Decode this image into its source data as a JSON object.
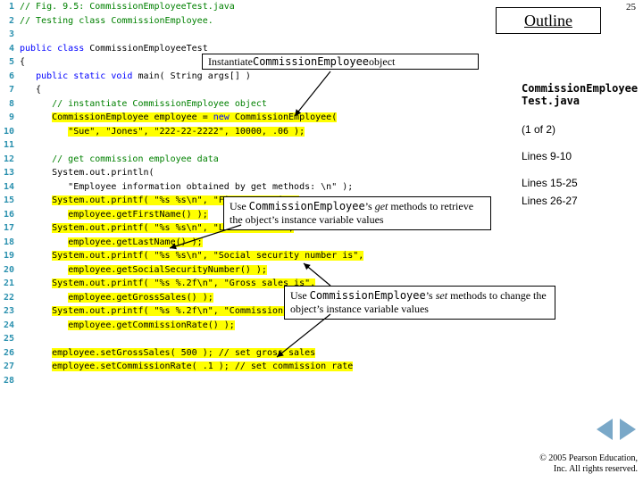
{
  "page_number": "25",
  "outline": "Outline",
  "side": {
    "filename_a": "CommissionEmployee",
    "filename_b": "Test.java",
    "part": "(1 of 2)",
    "lines_a": "Lines 9-10",
    "lines_b": "Lines 15-25",
    "lines_c": "Lines 26-27"
  },
  "callouts": {
    "c1_pre": "Instantiate ",
    "c1_mono": "CommissionEmployee",
    "c1_post": " object",
    "c2_pre": "Use ",
    "c2_mono": "CommissionEmployee",
    "c2_mid": "’s ",
    "c2_em": "get",
    "c2_post": " methods to retrieve the object’s instance variable values",
    "c3_pre": "Use ",
    "c3_mono": "CommissionEmployee",
    "c3_mid": "’s ",
    "c3_em": "set",
    "c3_post": " methods to change the object’s instance variable values"
  },
  "code": [
    {
      "n": "1",
      "cls": "cmt",
      "t": "// Fig. 9.5: CommissionEmployeeTest.java"
    },
    {
      "n": "2",
      "cls": "cmt",
      "t": "// Testing class CommissionEmployee."
    },
    {
      "n": "3",
      "cls": "",
      "t": ""
    },
    {
      "n": "4",
      "cls": "",
      "t": "<kw>public class</kw> CommissionEmployeeTest"
    },
    {
      "n": "5",
      "cls": "",
      "t": "{"
    },
    {
      "n": "6",
      "cls": "",
      "t": "   <kw>public static void</kw> main( String args[] )"
    },
    {
      "n": "7",
      "cls": "",
      "t": "   {"
    },
    {
      "n": "8",
      "cls": "cmt",
      "t": "      // instantiate CommissionEmployee object"
    },
    {
      "n": "9",
      "cls": "",
      "t": "      <str>CommissionEmployee employee = <kw>new</kw> CommissionEmployee(</str>"
    },
    {
      "n": "10",
      "cls": "",
      "t": "         <str>\"Sue\", \"Jones\", \"222-22-2222\", 10000, .06 );</str>"
    },
    {
      "n": "11",
      "cls": "",
      "t": ""
    },
    {
      "n": "12",
      "cls": "cmt",
      "t": "      // get commission employee data"
    },
    {
      "n": "13",
      "cls": "",
      "t": "      System.out.println("
    },
    {
      "n": "14",
      "cls": "",
      "t": "         \"Employee information obtained by get methods: \\n\" );"
    },
    {
      "n": "15",
      "cls": "",
      "t": "      <str>System.out.printf( \"%s %s\\n\", \"First name is\",</str>"
    },
    {
      "n": "16",
      "cls": "",
      "t": "         <str>employee.getFirstName() );</str>"
    },
    {
      "n": "17",
      "cls": "",
      "t": "      <str>System.out.printf( \"%s %s\\n\", \"Last name is\",</str>"
    },
    {
      "n": "18",
      "cls": "",
      "t": "         <str>employee.getLastName() );</str>"
    },
    {
      "n": "19",
      "cls": "",
      "t": "      <str>System.out.printf( \"%s %s\\n\", \"Social security number is\",</str>"
    },
    {
      "n": "20",
      "cls": "",
      "t": "         <str>employee.getSocialSecurityNumber() );</str>"
    },
    {
      "n": "21",
      "cls": "",
      "t": "      <str>System.out.printf( \"%s %.2f\\n\", \"Gross sales is\",</str>"
    },
    {
      "n": "22",
      "cls": "",
      "t": "         <str>employee.getGrossSales() );</str>"
    },
    {
      "n": "23",
      "cls": "",
      "t": "      <str>System.out.printf( \"%s %.2f\\n\", \"Commission rate is\",</str>"
    },
    {
      "n": "24",
      "cls": "",
      "t": "         <str>employee.getCommissionRate() );</str>"
    },
    {
      "n": "25",
      "cls": "",
      "t": ""
    },
    {
      "n": "26",
      "cls": "",
      "t": "      <str>employee.setGrossSales( 500 ); // set gross sales</str>"
    },
    {
      "n": "27",
      "cls": "",
      "t": "      <str>employee.setCommissionRate( .1 ); // set commission rate</str>"
    },
    {
      "n": "28",
      "cls": "",
      "t": ""
    }
  ],
  "footer": {
    "l1": "© 2005 Pearson Education,",
    "l2": "Inc.  All rights reserved."
  }
}
